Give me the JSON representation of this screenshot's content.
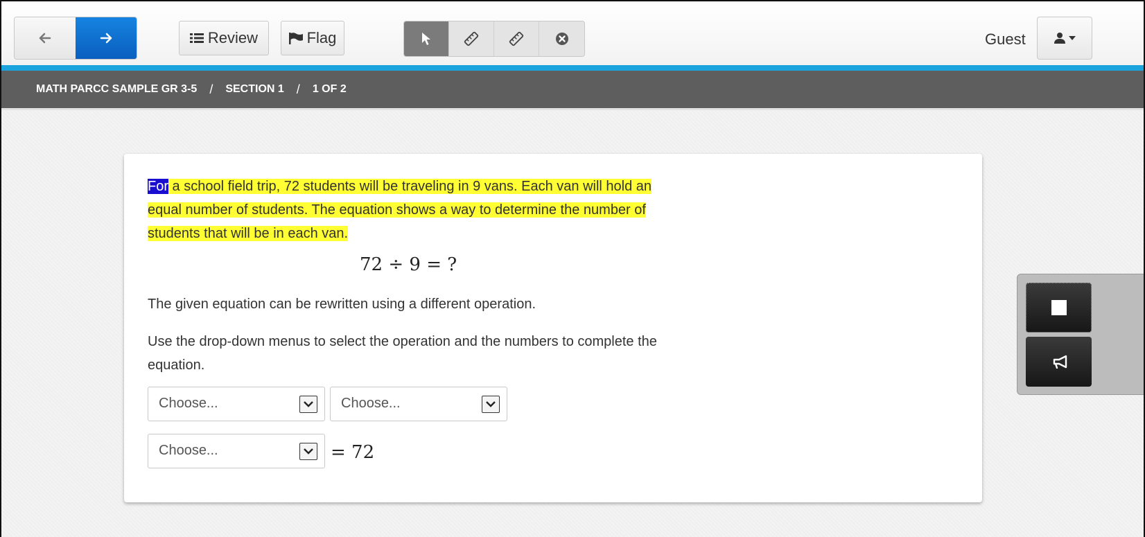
{
  "toolbar": {
    "back_icon": "arrow-left-icon",
    "next_icon": "arrow-right-icon",
    "review_label": "Review",
    "flag_label": "Flag",
    "tools": [
      "pointer-icon",
      "ruler-icon",
      "ruler-alt-icon",
      "close-circle-icon"
    ],
    "user_label": "Guest"
  },
  "breadcrumb": {
    "items": [
      "MATH PARCC SAMPLE GR 3-5",
      "SECTION 1",
      "1 OF 2"
    ],
    "separator": "/"
  },
  "question": {
    "passage_selected": "For",
    "passage_rest": " a school field trip, 72 students will be traveling in 9 vans. Each van will hold an equal number of students. The equation shows a way to determine the number of students that will be in each van.",
    "equation": "72 ÷ 9 = ?",
    "paragraph1": "The given equation can be rewritten using a different operation.",
    "paragraph2": "Use the drop-down menus to select the operation and the numbers to complete the equation.",
    "dropdown1_value": "Choose...",
    "dropdown2_value": "Choose...",
    "dropdown3_value": "Choose...",
    "result": "= 72"
  },
  "colors": {
    "accent_blue": "#1ba3dd",
    "next_button": "#0a5fbf",
    "highlight_yellow": "#ffff33",
    "highlight_selected": "#1a0fd0",
    "breadcrumb_bg": "#5e5e5e"
  },
  "side_panel": {
    "stop_icon": "stop-icon",
    "speak_icon": "megaphone-icon"
  }
}
